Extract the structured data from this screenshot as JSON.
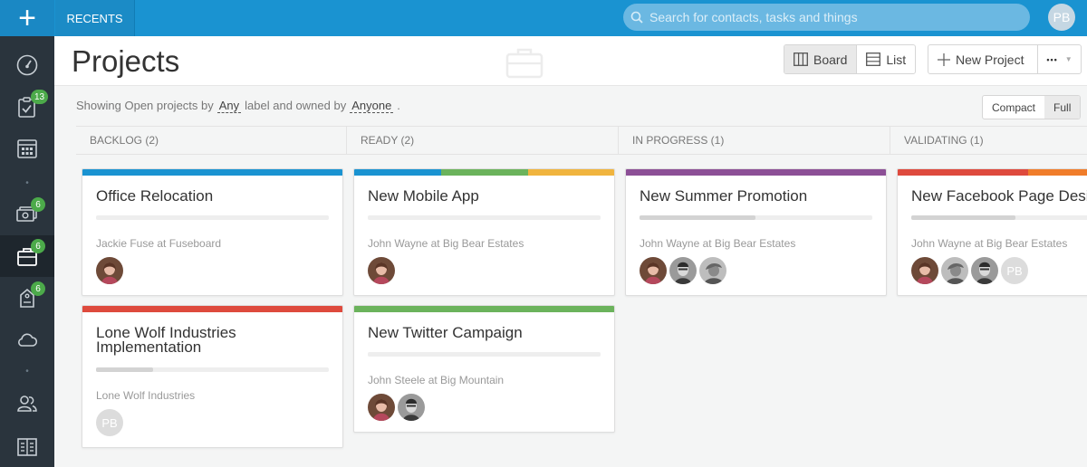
{
  "topbar": {
    "recents_label": "RECENTS",
    "search_placeholder": "Search for contacts, tasks and things",
    "user_initials": "PB"
  },
  "sidebar": {
    "items": [
      {
        "name": "dashboard",
        "badge": ""
      },
      {
        "name": "tasks",
        "badge": "13"
      },
      {
        "name": "calendar",
        "badge": ""
      },
      {
        "name": "deals",
        "badge": "6"
      },
      {
        "name": "projects",
        "badge": "6"
      },
      {
        "name": "cases",
        "badge": "6"
      },
      {
        "name": "cloud",
        "badge": ""
      },
      {
        "name": "contacts",
        "badge": ""
      },
      {
        "name": "reports",
        "badge": ""
      }
    ]
  },
  "header": {
    "title": "Projects",
    "board_label": "Board",
    "list_label": "List",
    "new_project_label": "New Project",
    "more_label": "•••"
  },
  "filter": {
    "prefix": "Showing Open projects by",
    "label_value": "Any",
    "middle": "label and owned by",
    "owner_value": "Anyone",
    "suffix": ".",
    "compact_label": "Compact",
    "full_label": "Full"
  },
  "columns": [
    {
      "title": "BACKLOG (2)"
    },
    {
      "title": "READY (2)"
    },
    {
      "title": "IN PROGRESS (1)"
    },
    {
      "title": "VALIDATING (1)"
    }
  ],
  "cards": [
    {
      "title": "Office Relocation",
      "owner": "Jackie Fuse at Fuseboard",
      "progress": 0,
      "stripe": [
        "#1a93d1"
      ]
    },
    {
      "title": "Lone Wolf Industries Implementation",
      "owner": "Lone Wolf Industries",
      "progress": 0.25,
      "stripe": [
        "#de4a3d"
      ],
      "initials": "PB"
    },
    {
      "title": "New Mobile App",
      "owner": "John Wayne at Big Bear Estates",
      "progress": 0,
      "stripe": [
        "#1a93d1",
        "#6bb35c",
        "#f0b43e"
      ]
    },
    {
      "title": "New Twitter Campaign",
      "owner": "John Steele at Big Mountain",
      "progress": 0,
      "stripe": [
        "#6bb35c"
      ]
    },
    {
      "title": "New Summer Promotion",
      "owner": "John Wayne at Big Bear Estates",
      "progress": 0.5,
      "stripe": [
        "#8c4f96"
      ]
    },
    {
      "title": "New Facebook Page Design",
      "owner": "John Wayne at Big Bear Estates",
      "progress": 0.45,
      "stripe": [
        "#de4a3d",
        "#f07d2a"
      ],
      "initials": "PB"
    }
  ],
  "colors": {
    "topbar": "#1a93d1",
    "sidebar": "#2a343d",
    "badge": "#4caa4a"
  }
}
